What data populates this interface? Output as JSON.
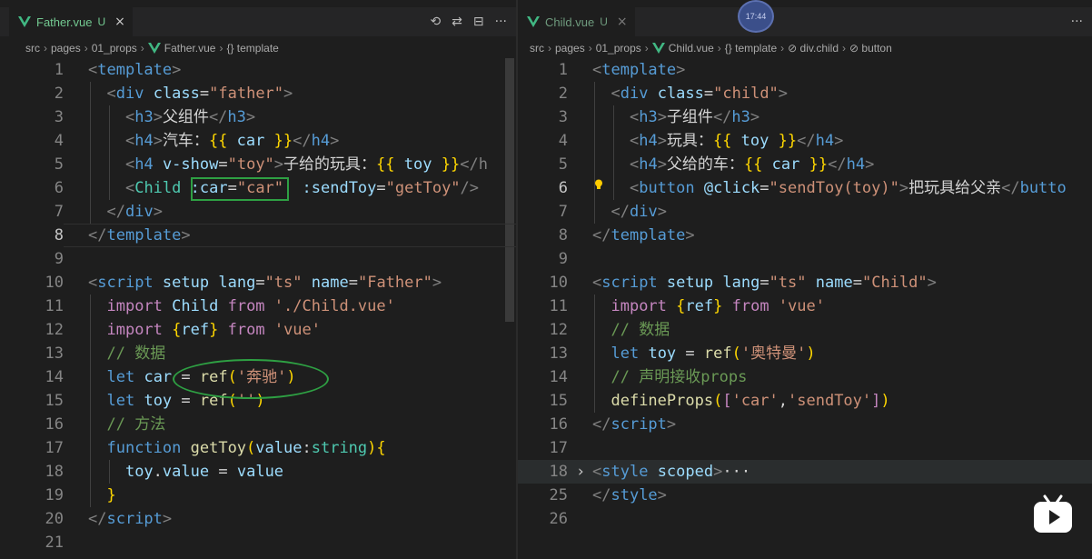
{
  "left": {
    "tab": {
      "label": "Father.vue",
      "status": "U",
      "close": "×"
    },
    "actions": [
      "⟲",
      "⇄",
      "⊟",
      "···"
    ],
    "breadcrumb": [
      "src",
      "pages",
      "01_props",
      "Father.vue",
      "{} template"
    ],
    "lines": [
      {
        "n": "1"
      },
      {
        "n": "2"
      },
      {
        "n": "3"
      },
      {
        "n": "4"
      },
      {
        "n": "5"
      },
      {
        "n": "6"
      },
      {
        "n": "7"
      },
      {
        "n": "8"
      },
      {
        "n": "9"
      },
      {
        "n": "10"
      },
      {
        "n": "11"
      },
      {
        "n": "12"
      },
      {
        "n": "13"
      },
      {
        "n": "14"
      },
      {
        "n": "15"
      },
      {
        "n": "16"
      },
      {
        "n": "17"
      },
      {
        "n": "18"
      },
      {
        "n": "19"
      },
      {
        "n": "20"
      },
      {
        "n": "21"
      }
    ],
    "code": {
      "l1_tag": "template",
      "l2_tag": "div",
      "l2_attr": "class",
      "l2_val": "\"father\"",
      "l3_tag": "h3",
      "l3_text": "父组件",
      "l4_tag": "h4",
      "l4_text": "汽车：",
      "l4_var": "car",
      "l5_tag": "h4",
      "l5_attr": "v-show",
      "l5_val": "\"toy\"",
      "l5_text": "子给的玩具：",
      "l5_var": "toy",
      "l6_tag": "Child",
      "l6_attr1": ":car",
      "l6_val1": "\"car\"",
      "l6_attr2": ":sendToy",
      "l6_val2": "\"getToy\"",
      "l7_tag": "div",
      "l8_tag": "template",
      "l10_tag": "script",
      "l10_attr1": "setup",
      "l10_attr2": "lang",
      "l10_val2": "\"ts\"",
      "l10_attr3": "name",
      "l10_val3": "\"Father\"",
      "l11_kw1": "import",
      "l11_id": "Child",
      "l11_kw2": "from",
      "l11_str": "'./Child.vue'",
      "l12_kw1": "import",
      "l12_id": "ref",
      "l12_kw2": "from",
      "l12_str": "'vue'",
      "l13_cm": "// 数据",
      "l14_kw": "let",
      "l14_var": "car",
      "l14_fn": "ref",
      "l14_str": "'奔驰'",
      "l15_kw": "let",
      "l15_var": "toy",
      "l15_fn": "ref",
      "l15_str": "''",
      "l16_cm": "// 方法",
      "l17_kw": "function",
      "l17_fn": "getToy",
      "l17_param": "value",
      "l17_type": "string",
      "l18_var": "toy",
      "l18_prop": "value",
      "l18_val": "value",
      "l20_tag": "script"
    }
  },
  "right": {
    "tab": {
      "label": "Child.vue",
      "status": "U",
      "close": "×"
    },
    "actions": [
      "···"
    ],
    "breadcrumb": [
      "src",
      "pages",
      "01_props",
      "Child.vue",
      "{} template",
      "⊘ div.child",
      "⊘ button"
    ],
    "lines": [
      {
        "n": "1"
      },
      {
        "n": "2"
      },
      {
        "n": "3"
      },
      {
        "n": "4"
      },
      {
        "n": "5"
      },
      {
        "n": "6"
      },
      {
        "n": "7"
      },
      {
        "n": "8"
      },
      {
        "n": "9"
      },
      {
        "n": "10"
      },
      {
        "n": "11"
      },
      {
        "n": "12"
      },
      {
        "n": "13"
      },
      {
        "n": "14"
      },
      {
        "n": "15"
      },
      {
        "n": "16"
      },
      {
        "n": "17"
      },
      {
        "n": "18"
      },
      {
        "n": "25"
      },
      {
        "n": "26"
      }
    ],
    "code": {
      "l1_tag": "template",
      "l2_tag": "div",
      "l2_attr": "class",
      "l2_val": "\"child\"",
      "l3_tag": "h3",
      "l3_text": "子组件",
      "l4_tag": "h4",
      "l4_text": "玩具：",
      "l4_var": "toy",
      "l5_tag": "h4",
      "l5_text": "父给的车：",
      "l5_var": "car",
      "l6_tag": "button",
      "l6_attr": "@click",
      "l6_val": "\"sendToy(toy)\"",
      "l6_text": "把玩具给父亲",
      "l6_close": "butto",
      "l7_tag": "div",
      "l8_tag": "template",
      "l10_tag": "script",
      "l10_attr1": "setup",
      "l10_attr2": "lang",
      "l10_val2": "\"ts\"",
      "l10_attr3": "name",
      "l10_val3": "\"Child\"",
      "l11_kw1": "import",
      "l11_id": "ref",
      "l11_kw2": "from",
      "l11_str": "'vue'",
      "l12_cm": "// 数据",
      "l13_kw": "let",
      "l13_var": "toy",
      "l13_fn": "ref",
      "l13_str": "'奥特曼'",
      "l14_cm": "// 声明接收props",
      "l15_fn": "defineProps",
      "l15_s1": "'car'",
      "l15_s2": "'sendToy'",
      "l16_tag": "script",
      "l18_tag": "style",
      "l18_attr": "scoped",
      "l18_fold": "···",
      "l25_tag": "style"
    }
  },
  "overlay": {
    "clock": "17:44"
  },
  "colors": {
    "accent_green": "#2ea043",
    "tab_modified": "#73c991"
  }
}
